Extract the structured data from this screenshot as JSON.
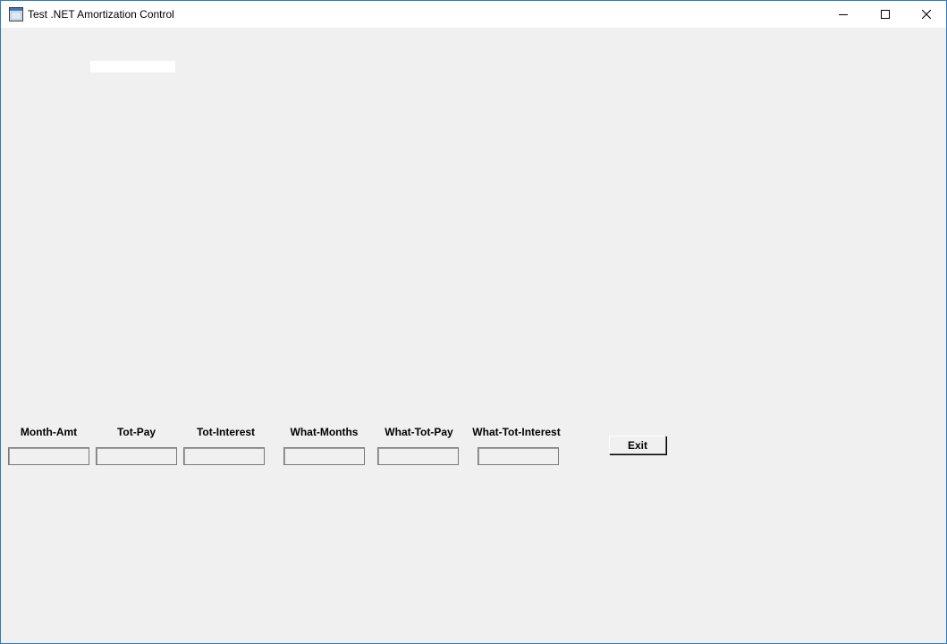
{
  "window": {
    "title": "Test .NET Amortization Control",
    "icon": "window-app-icon",
    "controls": {
      "minimize": "minimize-icon",
      "maximize": "maximize-icon",
      "close": "close-icon"
    }
  },
  "fields": [
    {
      "label": "Month-Amt",
      "value": ""
    },
    {
      "label": "Tot-Pay",
      "value": ""
    },
    {
      "label": "Tot-Interest",
      "value": ""
    },
    {
      "label": "What-Months",
      "value": ""
    },
    {
      "label": "What-Tot-Pay",
      "value": ""
    },
    {
      "label": "What-Tot-Interest",
      "value": ""
    }
  ],
  "buttons": {
    "exit_label": "Exit"
  },
  "colors": {
    "background": "#f0f0f0",
    "titlebar": "#ffffff",
    "window_border": "#2b7bc0"
  }
}
